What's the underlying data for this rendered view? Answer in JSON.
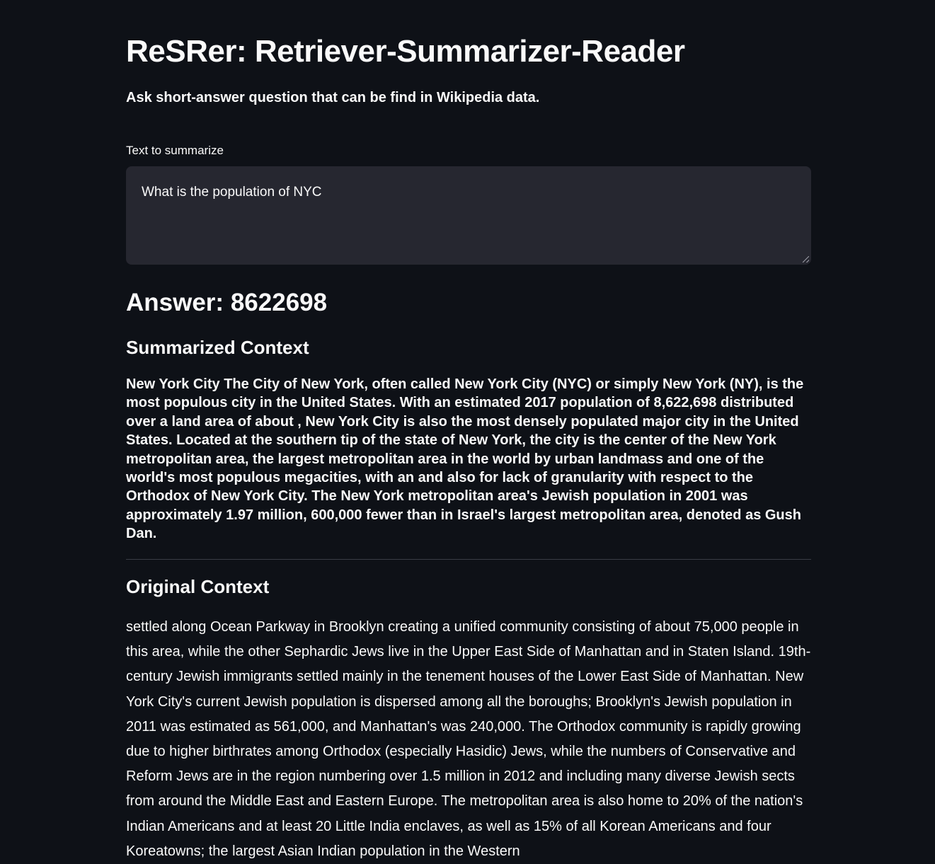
{
  "app": {
    "title": "ReSRer: Retriever-Summarizer-Reader",
    "subtitle": "Ask short-answer question that can be find in Wikipedia data."
  },
  "input": {
    "label": "Text to summarize",
    "value": "What is the population of NYC"
  },
  "answer": {
    "prefix": "Answer:",
    "value": "8622698"
  },
  "summarized": {
    "heading": "Summarized Context",
    "text": "New York City The City of New York, often called New York City (NYC) or simply New York (NY), is the most populous city in the United States. With an estimated 2017 population of 8,622,698 distributed over a land area of about , New York City is also the most densely populated major city in the United States. Located at the southern tip of the state of New York, the city is the center of the New York metropolitan area, the largest metropolitan area in the world by urban landmass and one of the world's most populous megacities, with an and also for lack of granularity with respect to the Orthodox of New York City. The New York metropolitan area's Jewish population in 2001 was approximately 1.97 million, 600,000 fewer than in Israel's largest metropolitan area, denoted as Gush Dan."
  },
  "original": {
    "heading": "Original Context",
    "text": "settled along Ocean Parkway in Brooklyn creating a unified community consisting of about 75,000 people in this area, while the other Sephardic Jews live in the Upper East Side of Manhattan and in Staten Island. 19th-century Jewish immigrants settled mainly in the tenement houses of the Lower East Side of Manhattan. New York City's current Jewish population is dispersed among all the boroughs; Brooklyn's Jewish population in 2011 was estimated as 561,000, and Manhattan's was 240,000. The Orthodox community is rapidly growing due to higher birthrates among Orthodox (especially Hasidic) Jews, while the numbers of Conservative and Reform Jews are in the region numbering over 1.5 million in 2012 and including many diverse Jewish sects from around the Middle East and Eastern Europe. The metropolitan area is also home to 20% of the nation's Indian Americans and at least 20 Little India enclaves, as well as 15% of all Korean Americans and four Koreatowns; the largest Asian Indian population in the Western"
  }
}
